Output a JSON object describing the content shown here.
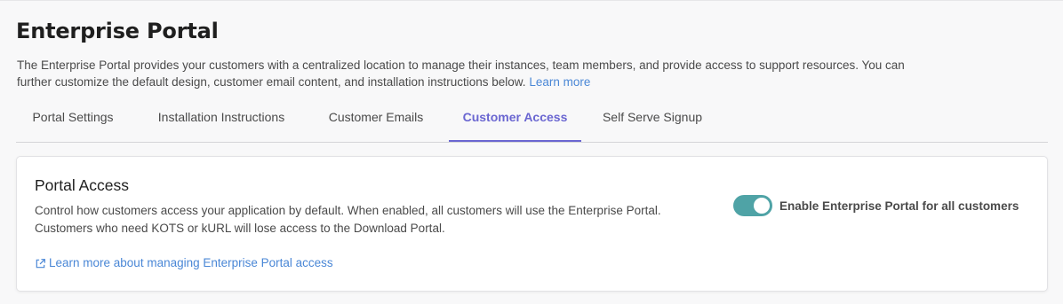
{
  "header": {
    "title": "Enterprise Portal",
    "description": "The Enterprise Portal provides your customers with a centralized location to manage their instances, team members, and provide access to support resources. You can further customize the default design, customer email content, and installation instructions below.",
    "learn_more": "Learn more"
  },
  "tabs": [
    {
      "label": "Portal Settings",
      "active": false
    },
    {
      "label": "Installation Instructions",
      "active": false
    },
    {
      "label": "Customer Emails",
      "active": false
    },
    {
      "label": "Customer Access",
      "active": true
    },
    {
      "label": "Self Serve Signup",
      "active": false
    }
  ],
  "portal_access": {
    "title": "Portal Access",
    "description": "Control how customers access your application by default. When enabled, all customers will use the Enterprise Portal. Customers who need KOTS or kURL will lose access to the Download Portal.",
    "link_label": "Learn more about managing Enterprise Portal access",
    "link_icon": "external-link-icon",
    "toggle": {
      "label": "Enable Enterprise Portal for all customers",
      "enabled": true
    }
  },
  "colors": {
    "accent": "#6a66d1",
    "link": "#4a87d6",
    "toggle_on": "#4fa3a6"
  }
}
